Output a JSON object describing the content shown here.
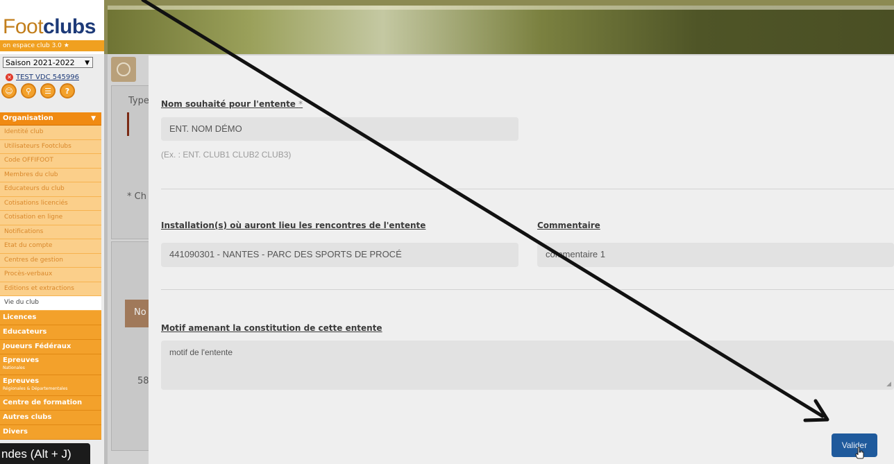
{
  "branding": {
    "logo_part1": "Foot",
    "logo_part2": "clubs",
    "subtitle": "on espace club 3.0 ★"
  },
  "sidebar": {
    "season": "Saison 2021-2022",
    "club_name": "TEST VDC 545996",
    "toolbar_icons": [
      "user-icon",
      "search-icon",
      "document-icon",
      "help-icon"
    ],
    "organisation": {
      "label": "Organisation",
      "items": [
        "Identité club",
        "Utilisateurs Footclubs",
        "Code OFFIFOOT",
        "Membres du club",
        "Educateurs du club",
        "Cotisations licenciés",
        "Cotisation en ligne",
        "Notifications",
        "Etat du compte",
        "Centres de gestion",
        "Procès-verbaux",
        "Editions et extractions",
        "Vie du club"
      ]
    },
    "categories": [
      {
        "label": "Licences"
      },
      {
        "label": "Educateurs"
      },
      {
        "label": "Joueurs Fédéraux"
      },
      {
        "label": "Epreuves",
        "sub": "Nationales"
      },
      {
        "label": "Epreuves",
        "sub": "Régionales & Départementales"
      },
      {
        "label": "Centre de formation"
      },
      {
        "label": "Autres clubs"
      },
      {
        "label": "Divers"
      }
    ]
  },
  "background_page": {
    "type_label": "Type",
    "ch_label": "* Ch",
    "no_label": "No",
    "num_label": "58"
  },
  "modal": {
    "name_label": "Nom souhaité pour l'entente",
    "name_value": "ENT. NOM DÉMO",
    "name_hint": "(Ex. : ENT. CLUB1 CLUB2 CLUB3)",
    "install_label": "Installation(s) où auront lieu les rencontres de l'entente",
    "install_value": "441090301 - NANTES - PARC DES SPORTS DE PROCÉ",
    "comment_label": "Commentaire",
    "comment_value": "commentaire 1",
    "motif_label": "Motif amenant la constitution de cette entente",
    "motif_value": "motif de l'entente",
    "submit_label": "Valider",
    "required_mark": "*"
  },
  "tooltip": {
    "text": "ndes (Alt + J)"
  },
  "colors": {
    "accent_orange": "#f08a12",
    "submit_blue": "#1f5a9c",
    "link_blue": "#1d3a78"
  }
}
